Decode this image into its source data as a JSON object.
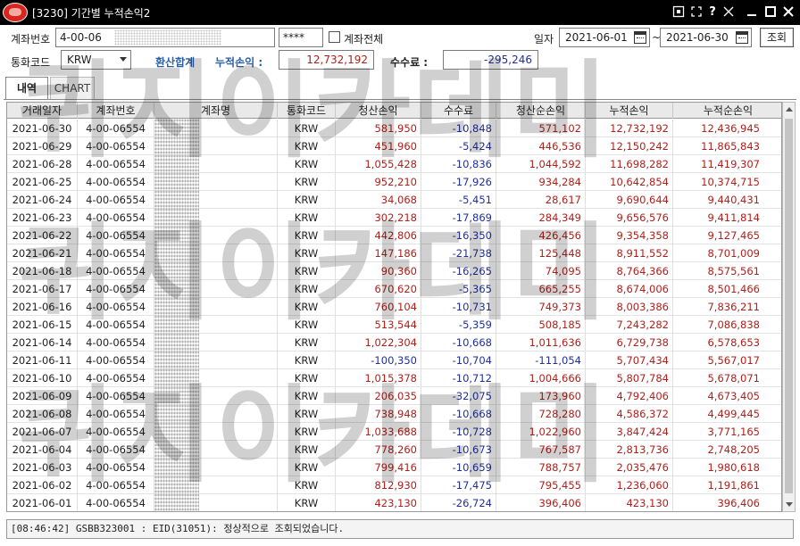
{
  "window": {
    "title": "[3230] 기간별 누적손익2",
    "logo_text": "Futures",
    "controls": [
      "restore-icon",
      "pin-icon",
      "help-icon",
      "resize-icon",
      "minimize-icon",
      "maximize-icon",
      "close-icon"
    ]
  },
  "filters": {
    "account_label": "계좌번호",
    "account_value": "4-00-06",
    "password_value": "****",
    "all_accounts_label": "계좌전체",
    "all_accounts_checked": false,
    "date_label": "일자",
    "date_from": "2021-06-01",
    "date_separator": "~",
    "date_to": "2021-06-30",
    "query_button": "조회",
    "currency_label": "통화코드",
    "currency_value": "KRW",
    "converted_total_label": "환산합계",
    "cumulative_pl_label": "누적손익 :",
    "cumulative_pl_value": "12,732,192",
    "fee_label": "수수료 :",
    "fee_value": "-295,246"
  },
  "tabs": [
    {
      "label": "내역",
      "active": true
    },
    {
      "label": "CHART",
      "active": false
    }
  ],
  "columns": [
    "거래일자",
    "계좌번호",
    "계좌명",
    "통화코드",
    "청산손익",
    "수수료",
    "청산순손익",
    "누적손익",
    "누적순손익"
  ],
  "rows": [
    {
      "date": "2021-06-30",
      "account": "4-00-06554",
      "name": "",
      "currency": "KRW",
      "realized_pl": "581,950",
      "fee": "-10,848",
      "net_pl": "571,102",
      "cum_pl": "12,732,192",
      "cum_net_pl": "12,436,945"
    },
    {
      "date": "2021-06-29",
      "account": "4-00-06554",
      "name": "",
      "currency": "KRW",
      "realized_pl": "451,960",
      "fee": "-5,424",
      "net_pl": "446,536",
      "cum_pl": "12,150,242",
      "cum_net_pl": "11,865,843"
    },
    {
      "date": "2021-06-28",
      "account": "4-00-06554",
      "name": "",
      "currency": "KRW",
      "realized_pl": "1,055,428",
      "fee": "-10,836",
      "net_pl": "1,044,592",
      "cum_pl": "11,698,282",
      "cum_net_pl": "11,419,307"
    },
    {
      "date": "2021-06-25",
      "account": "4-00-06554",
      "name": "",
      "currency": "KRW",
      "realized_pl": "952,210",
      "fee": "-17,926",
      "net_pl": "934,284",
      "cum_pl": "10,642,854",
      "cum_net_pl": "10,374,715"
    },
    {
      "date": "2021-06-24",
      "account": "4-00-06554",
      "name": "",
      "currency": "KRW",
      "realized_pl": "34,068",
      "fee": "-5,451",
      "net_pl": "28,617",
      "cum_pl": "9,690,644",
      "cum_net_pl": "9,440,431"
    },
    {
      "date": "2021-06-23",
      "account": "4-00-06554",
      "name": "",
      "currency": "KRW",
      "realized_pl": "302,218",
      "fee": "-17,869",
      "net_pl": "284,349",
      "cum_pl": "9,656,576",
      "cum_net_pl": "9,411,814"
    },
    {
      "date": "2021-06-22",
      "account": "4-00-06554",
      "name": "",
      "currency": "KRW",
      "realized_pl": "442,806",
      "fee": "-16,350",
      "net_pl": "426,456",
      "cum_pl": "9,354,358",
      "cum_net_pl": "9,127,465"
    },
    {
      "date": "2021-06-21",
      "account": "4-00-06554",
      "name": "",
      "currency": "KRW",
      "realized_pl": "147,186",
      "fee": "-21,738",
      "net_pl": "125,448",
      "cum_pl": "8,911,552",
      "cum_net_pl": "8,701,009"
    },
    {
      "date": "2021-06-18",
      "account": "4-00-06554",
      "name": "",
      "currency": "KRW",
      "realized_pl": "90,360",
      "fee": "-16,265",
      "net_pl": "74,095",
      "cum_pl": "8,764,366",
      "cum_net_pl": "8,575,561"
    },
    {
      "date": "2021-06-17",
      "account": "4-00-06554",
      "name": "",
      "currency": "KRW",
      "realized_pl": "670,620",
      "fee": "-5,365",
      "net_pl": "665,255",
      "cum_pl": "8,674,006",
      "cum_net_pl": "8,501,466"
    },
    {
      "date": "2021-06-16",
      "account": "4-00-06554",
      "name": "",
      "currency": "KRW",
      "realized_pl": "760,104",
      "fee": "-10,731",
      "net_pl": "749,373",
      "cum_pl": "8,003,386",
      "cum_net_pl": "7,836,211"
    },
    {
      "date": "2021-06-15",
      "account": "4-00-06554",
      "name": "",
      "currency": "KRW",
      "realized_pl": "513,544",
      "fee": "-5,359",
      "net_pl": "508,185",
      "cum_pl": "7,243,282",
      "cum_net_pl": "7,086,838"
    },
    {
      "date": "2021-06-14",
      "account": "4-00-06554",
      "name": "",
      "currency": "KRW",
      "realized_pl": "1,022,304",
      "fee": "-10,668",
      "net_pl": "1,011,636",
      "cum_pl": "6,729,738",
      "cum_net_pl": "6,578,653"
    },
    {
      "date": "2021-06-11",
      "account": "4-00-06554",
      "name": "",
      "currency": "KRW",
      "realized_pl": "-100,350",
      "fee": "-10,704",
      "net_pl": "-111,054",
      "cum_pl": "5,707,434",
      "cum_net_pl": "5,567,017"
    },
    {
      "date": "2021-06-10",
      "account": "4-00-06554",
      "name": "",
      "currency": "KRW",
      "realized_pl": "1,015,378",
      "fee": "-10,712",
      "net_pl": "1,004,666",
      "cum_pl": "5,807,784",
      "cum_net_pl": "5,678,071"
    },
    {
      "date": "2021-06-09",
      "account": "4-00-06554",
      "name": "",
      "currency": "KRW",
      "realized_pl": "206,035",
      "fee": "-32,075",
      "net_pl": "173,960",
      "cum_pl": "4,792,406",
      "cum_net_pl": "4,673,405"
    },
    {
      "date": "2021-06-08",
      "account": "4-00-06554",
      "name": "",
      "currency": "KRW",
      "realized_pl": "738,948",
      "fee": "-10,668",
      "net_pl": "728,280",
      "cum_pl": "4,586,372",
      "cum_net_pl": "4,499,445"
    },
    {
      "date": "2021-06-07",
      "account": "4-00-06554",
      "name": "",
      "currency": "KRW",
      "realized_pl": "1,033,688",
      "fee": "-10,728",
      "net_pl": "1,022,960",
      "cum_pl": "3,847,424",
      "cum_net_pl": "3,771,165"
    },
    {
      "date": "2021-06-04",
      "account": "4-00-06554",
      "name": "",
      "currency": "KRW",
      "realized_pl": "778,260",
      "fee": "-10,673",
      "net_pl": "767,587",
      "cum_pl": "2,813,736",
      "cum_net_pl": "2,748,205"
    },
    {
      "date": "2021-06-03",
      "account": "4-00-06554",
      "name": "",
      "currency": "KRW",
      "realized_pl": "799,416",
      "fee": "-10,659",
      "net_pl": "788,757",
      "cum_pl": "2,035,476",
      "cum_net_pl": "1,980,618"
    },
    {
      "date": "2021-06-02",
      "account": "4-00-06554",
      "name": "",
      "currency": "KRW",
      "realized_pl": "812,930",
      "fee": "-17,475",
      "net_pl": "795,455",
      "cum_pl": "1,236,060",
      "cum_net_pl": "1,191,861"
    },
    {
      "date": "2021-06-01",
      "account": "4-00-06554",
      "name": "",
      "currency": "KRW",
      "realized_pl": "423,130",
      "fee": "-26,724",
      "net_pl": "396,406",
      "cum_pl": "423,130",
      "cum_net_pl": "396,406"
    }
  ],
  "status": {
    "message": "[08:46:42] GSBB323001 : EID(31051): 정상적으로 조회되었습니다."
  },
  "watermark": {
    "lines": [
      "퀴지이카데미",
      "퀴지이카데미",
      "퀴지이카데미"
    ]
  },
  "colors": {
    "positive": "#b0201a",
    "negative": "#1f2fa0",
    "title_bar": "#000000",
    "accent_blue": "#2b5ea8"
  }
}
